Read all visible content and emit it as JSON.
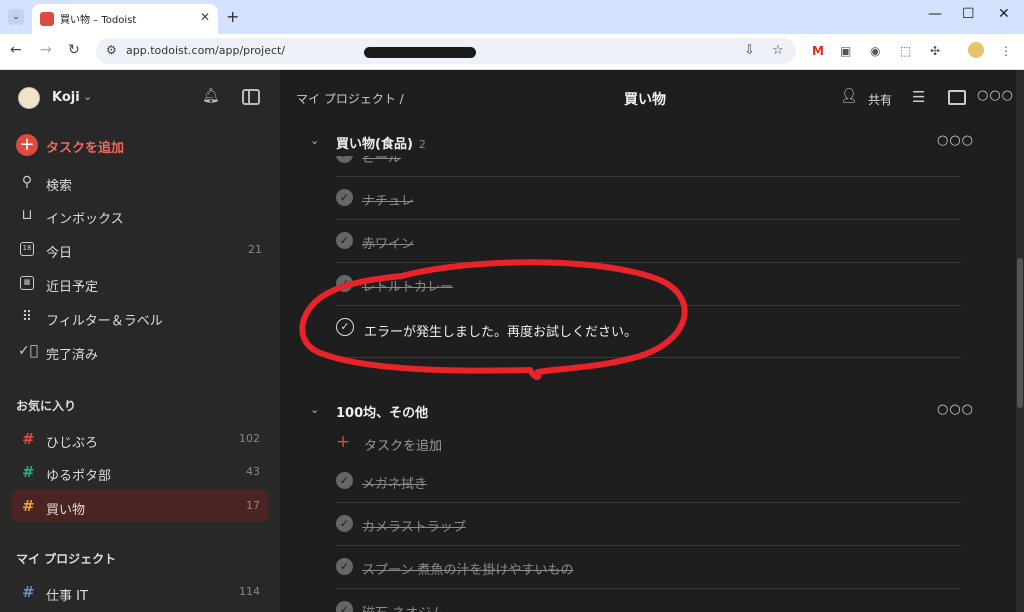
{
  "browser": {
    "tab_title": "買い物 – Todoist",
    "new_tab": "+",
    "url_text": "app.todoist.com/app/project/",
    "colors": {
      "tabstrip": "#d3e3fd",
      "toolbar": "#ffffff"
    }
  },
  "sidebar": {
    "user_name": "Koji",
    "add_task": "タスクを追加",
    "nav": [
      {
        "label": "検索",
        "icon": "search-icon",
        "count": ""
      },
      {
        "label": "インボックス",
        "icon": "inbox-icon",
        "count": ""
      },
      {
        "label": "今日",
        "icon": "calendar-today-icon",
        "count": "21"
      },
      {
        "label": "近日予定",
        "icon": "calendar-upcoming-icon",
        "count": ""
      },
      {
        "label": "フィルター＆ラベル",
        "icon": "filters-icon",
        "count": ""
      },
      {
        "label": "完了済み",
        "icon": "completed-icon",
        "count": ""
      }
    ],
    "favorites_heading": "お気に入り",
    "favorites": [
      {
        "label": "ひじぶろ",
        "count": "102",
        "hash_color": "#db4c3f"
      },
      {
        "label": "ゆるポタ部",
        "count": "43",
        "hash_color": "#2aaa8a"
      },
      {
        "label": "買い物",
        "count": "17",
        "hash_color": "#e6a23c"
      }
    ],
    "projects_heading": "マイ プロジェクト",
    "projects": [
      {
        "label": "仕事 IT",
        "count": "114",
        "hash_color": "#6b8cc9"
      }
    ]
  },
  "header": {
    "breadcrumb": "マイ プロジェクト /",
    "title": "買い物",
    "share_label": "共有"
  },
  "sections": [
    {
      "title": "買い物(食品)",
      "count": "2",
      "tasks": [
        "ビール",
        "ナチュレ",
        "赤ワイン",
        "レトルトカレー"
      ],
      "error_message": "エラーが発生しました。再度お試しください。"
    },
    {
      "title": "100均、その他",
      "count": "",
      "add_task": "タスクを追加",
      "tasks": [
        "メガネ拭き",
        "カメラストラップ",
        "スプーン 煮魚の汁を掛けやすいもの",
        "磁石 ネオジム"
      ]
    }
  ],
  "colors": {
    "accent_red": "#db4c3f",
    "sidebar_bg": "#282828",
    "main_bg": "#1e1e1e",
    "annotation_red": "#e8232a"
  }
}
